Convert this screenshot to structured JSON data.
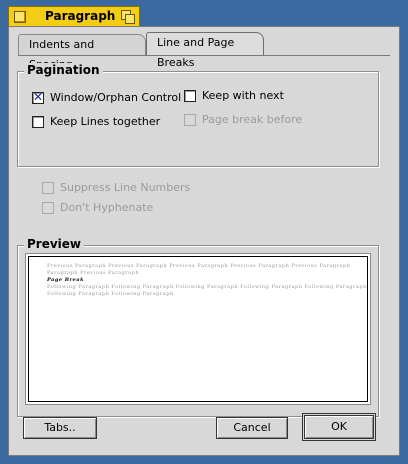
{
  "window": {
    "title": "Paragraph"
  },
  "tabs": [
    {
      "label": "Indents and Spacing",
      "active": false
    },
    {
      "label": "Line and Page Breaks",
      "active": true
    }
  ],
  "pagination": {
    "title": "Pagination",
    "widow_orphan": {
      "label": "Window/Orphan Control",
      "checked": true,
      "enabled": true
    },
    "keep_lines": {
      "label": "Keep Lines together",
      "checked": false,
      "enabled": true
    },
    "keep_next": {
      "label": "Keep with next",
      "checked": false,
      "enabled": true
    },
    "page_break": {
      "label": "Page break before",
      "checked": false,
      "enabled": false
    }
  },
  "extras": {
    "suppress": {
      "label": "Suppress Line Numbers",
      "checked": false,
      "enabled": false
    },
    "hyphenate": {
      "label": "Don't Hyphenate",
      "checked": false,
      "enabled": false
    }
  },
  "preview": {
    "title": "Preview",
    "lines": [
      "Previous Paragraph Previous Paragraph Previous Paragraph Previous Paragraph Previous Paragraph",
      "Paragraph Previous Paragraph",
      "Page Break",
      "Following Paragraph Following Paragraph Following Paragraph Following Paragraph Following Paragraph",
      "Following Paragraph Following Paragraph"
    ]
  },
  "buttons": {
    "tabs": "Tabs..",
    "cancel": "Cancel",
    "ok": "OK"
  },
  "colors": {
    "desktop": "#3b6aa1",
    "titlebar": "#f4cd16",
    "check": "#1e2aa0"
  }
}
